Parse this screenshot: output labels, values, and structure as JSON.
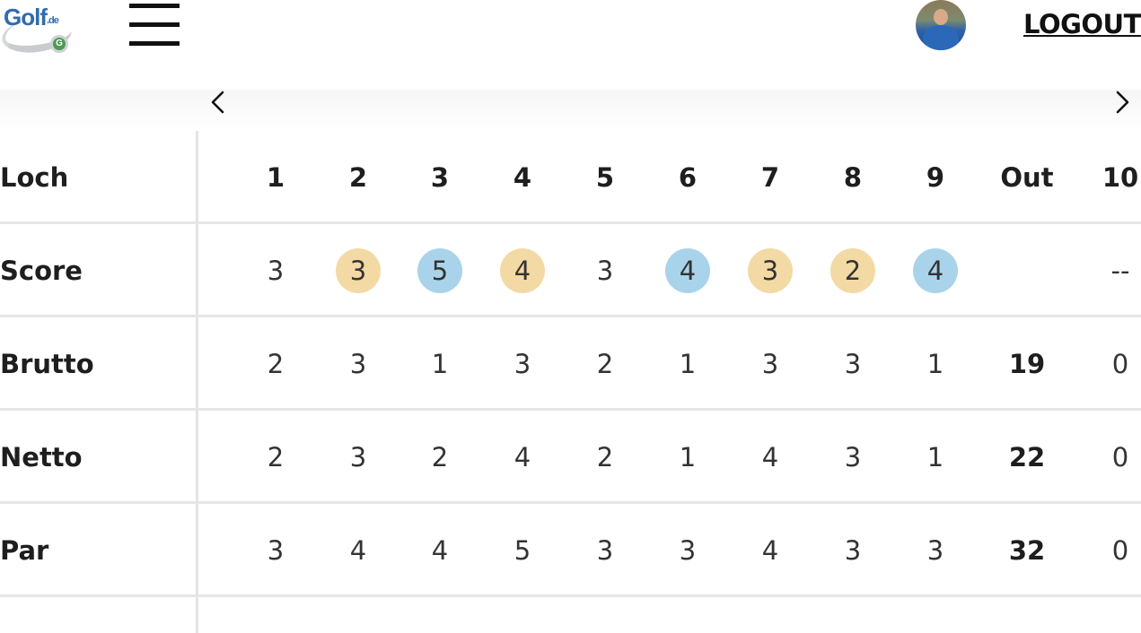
{
  "header": {
    "logo_text": "Golf",
    "logo_suffix": ".de",
    "logo_badge": "G",
    "logout_label": "LOGOUT",
    "icons": [
      "hamburger-menu-icon",
      "avatar",
      "chevron-left-icon",
      "chevron-right-icon"
    ]
  },
  "colors": {
    "score_better": "#f3d9a3",
    "score_worse": "#a9d3ea",
    "divider": "#e6e6e6"
  },
  "scorecard": {
    "header_row": {
      "label": "Loch",
      "cells": [
        "1",
        "2",
        "3",
        "4",
        "5",
        "6",
        "7",
        "8",
        "9",
        "Out",
        "10"
      ]
    },
    "rows": [
      {
        "label": "Score",
        "cells": [
          "3",
          "3",
          "5",
          "4",
          "3",
          "4",
          "3",
          "2",
          "4",
          "",
          "--"
        ],
        "highlight": [
          "",
          "orange",
          "blue",
          "orange",
          "",
          "blue",
          "orange",
          "orange",
          "blue",
          "",
          ""
        ]
      },
      {
        "label": "Brutto",
        "cells": [
          "2",
          "3",
          "1",
          "3",
          "2",
          "1",
          "3",
          "3",
          "1",
          "19",
          "0"
        ]
      },
      {
        "label": "Netto",
        "cells": [
          "2",
          "3",
          "2",
          "4",
          "2",
          "1",
          "4",
          "3",
          "1",
          "22",
          "0"
        ]
      },
      {
        "label": "Par",
        "cells": [
          "3",
          "4",
          "4",
          "5",
          "3",
          "3",
          "4",
          "3",
          "3",
          "32",
          "0"
        ]
      }
    ]
  }
}
